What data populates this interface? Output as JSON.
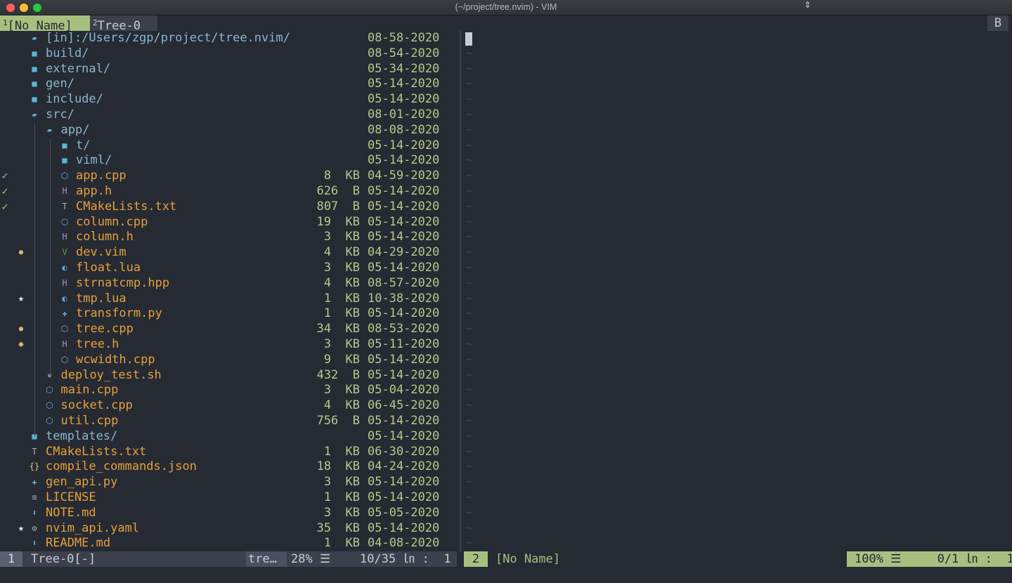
{
  "window": {
    "title": "(~/project/tree.nvim) - VIM"
  },
  "tabline": {
    "tabs": [
      {
        "number": "1",
        "label": "[No Name]",
        "active": true
      },
      {
        "number": "2",
        "label": "Tree-0",
        "active": false
      }
    ],
    "right_indicator": "B"
  },
  "tree": {
    "rows": [
      {
        "name": "[in]:/Users/zgp/project/tree.nvim/",
        "kind": "dir",
        "icon": "folder-open-icon",
        "depth": 0,
        "size": "",
        "date": "08-58-2020",
        "git": "",
        "mark": ""
      },
      {
        "name": "build/",
        "kind": "dir",
        "icon": "folder-icon",
        "depth": 0,
        "size": "",
        "date": "08-54-2020",
        "git": "",
        "mark": ""
      },
      {
        "name": "external/",
        "kind": "dir",
        "icon": "folder-icon",
        "depth": 0,
        "size": "",
        "date": "05-34-2020",
        "git": "",
        "mark": ""
      },
      {
        "name": "gen/",
        "kind": "dir",
        "icon": "folder-icon",
        "depth": 0,
        "size": "",
        "date": "05-14-2020",
        "git": "",
        "mark": ""
      },
      {
        "name": "include/",
        "kind": "dir",
        "icon": "folder-icon",
        "depth": 0,
        "size": "",
        "date": "05-14-2020",
        "git": "",
        "mark": ""
      },
      {
        "name": "src/",
        "kind": "dir",
        "icon": "folder-open-icon",
        "depth": 0,
        "size": "",
        "date": "08-01-2020",
        "git": "",
        "mark": ""
      },
      {
        "name": "app/",
        "kind": "dir",
        "icon": "folder-open-icon",
        "depth": 1,
        "size": "",
        "date": "08-08-2020",
        "git": "",
        "mark": ""
      },
      {
        "name": "t/",
        "kind": "dir",
        "icon": "folder-icon",
        "depth": 2,
        "size": "",
        "date": "05-14-2020",
        "git": "",
        "mark": ""
      },
      {
        "name": "viml/",
        "kind": "dir",
        "icon": "folder-icon",
        "depth": 2,
        "size": "",
        "date": "05-14-2020",
        "git": "",
        "mark": ""
      },
      {
        "name": "app.cpp",
        "kind": "file",
        "icon": "cpp-icon",
        "depth": 2,
        "size": "8  KB",
        "date": "04-59-2020",
        "git": "✓",
        "mark": ""
      },
      {
        "name": "app.h",
        "kind": "file",
        "icon": "header-icon",
        "depth": 2,
        "size": "626  B",
        "date": "05-14-2020",
        "git": "✓",
        "mark": ""
      },
      {
        "name": "CMakeLists.txt",
        "kind": "file",
        "icon": "text-icon",
        "depth": 2,
        "size": "807  B",
        "date": "05-14-2020",
        "git": "✓",
        "mark": ""
      },
      {
        "name": "column.cpp",
        "kind": "file",
        "icon": "cpp-icon",
        "depth": 2,
        "size": "19  KB",
        "date": "05-14-2020",
        "git": "",
        "mark": ""
      },
      {
        "name": "column.h",
        "kind": "file",
        "icon": "header-icon",
        "depth": 2,
        "size": "3  KB",
        "date": "05-14-2020",
        "git": "",
        "mark": ""
      },
      {
        "name": "dev.vim",
        "kind": "file",
        "icon": "vim-icon",
        "depth": 2,
        "size": "4  KB",
        "date": "04-29-2020",
        "git": "",
        "mark": "✹"
      },
      {
        "name": "float.lua",
        "kind": "file",
        "icon": "lua-icon",
        "depth": 2,
        "size": "3  KB",
        "date": "05-14-2020",
        "git": "",
        "mark": ""
      },
      {
        "name": "strnatcmp.hpp",
        "kind": "file",
        "icon": "header-icon",
        "depth": 2,
        "size": "4  KB",
        "date": "08-57-2020",
        "git": "",
        "mark": ""
      },
      {
        "name": "tmp.lua",
        "kind": "file",
        "icon": "lua-icon",
        "depth": 2,
        "size": "1  KB",
        "date": "10-38-2020",
        "git": "",
        "mark": "★"
      },
      {
        "name": "transform.py",
        "kind": "file",
        "icon": "python-icon",
        "depth": 2,
        "size": "1  KB",
        "date": "05-14-2020",
        "git": "",
        "mark": ""
      },
      {
        "name": "tree.cpp",
        "kind": "file",
        "icon": "cpp-icon",
        "depth": 2,
        "size": "34  KB",
        "date": "08-53-2020",
        "git": "",
        "mark": "✹"
      },
      {
        "name": "tree.h",
        "kind": "file",
        "icon": "header-icon",
        "depth": 2,
        "size": "3  KB",
        "date": "05-11-2020",
        "git": "",
        "mark": "✹"
      },
      {
        "name": "wcwidth.cpp",
        "kind": "file",
        "icon": "cpp-icon",
        "depth": 2,
        "size": "9  KB",
        "date": "05-14-2020",
        "git": "",
        "mark": ""
      },
      {
        "name": "deploy_test.sh",
        "kind": "file",
        "icon": "shell-icon",
        "depth": 1,
        "size": "432  B",
        "date": "05-14-2020",
        "git": "",
        "mark": ""
      },
      {
        "name": "main.cpp",
        "kind": "file",
        "icon": "cpp-icon",
        "depth": 1,
        "size": "3  KB",
        "date": "05-04-2020",
        "git": "",
        "mark": ""
      },
      {
        "name": "socket.cpp",
        "kind": "file",
        "icon": "cpp-icon",
        "depth": 1,
        "size": "4  KB",
        "date": "06-45-2020",
        "git": "",
        "mark": ""
      },
      {
        "name": "util.cpp",
        "kind": "file",
        "icon": "cpp-icon",
        "depth": 1,
        "size": "756  B",
        "date": "05-14-2020",
        "git": "",
        "mark": ""
      },
      {
        "name": "templates/",
        "kind": "dir",
        "icon": "folder-icon",
        "depth": 0,
        "size": "",
        "date": "05-14-2020",
        "git": "",
        "mark": ""
      },
      {
        "name": "CMakeLists.txt",
        "kind": "file",
        "icon": "text-icon",
        "depth": 0,
        "size": "1  KB",
        "date": "06-30-2020",
        "git": "",
        "mark": ""
      },
      {
        "name": "compile_commands.json",
        "kind": "file",
        "icon": "json-icon",
        "depth": 0,
        "size": "18  KB",
        "date": "04-24-2020",
        "git": "",
        "mark": ""
      },
      {
        "name": "gen_api.py",
        "kind": "file",
        "icon": "python-icon",
        "depth": 0,
        "size": "3  KB",
        "date": "05-14-2020",
        "git": "",
        "mark": ""
      },
      {
        "name": "LICENSE",
        "kind": "file",
        "icon": "license-icon",
        "depth": 0,
        "size": "1  KB",
        "date": "05-14-2020",
        "git": "",
        "mark": ""
      },
      {
        "name": "NOTE.md",
        "kind": "file",
        "icon": "markdown-icon",
        "depth": 0,
        "size": "3  KB",
        "date": "05-05-2020",
        "git": "",
        "mark": ""
      },
      {
        "name": "nvim_api.yaml",
        "kind": "file",
        "icon": "yaml-icon",
        "depth": 0,
        "size": "35  KB",
        "date": "05-14-2020",
        "git": "",
        "mark": "★"
      },
      {
        "name": "README.md",
        "kind": "file",
        "icon": "markdown-icon",
        "depth": 0,
        "size": "1  KB",
        "date": "04-08-2020",
        "git": "",
        "mark": ""
      }
    ]
  },
  "editor": {
    "tilde": "~",
    "empty_line_count": 33
  },
  "statusline": {
    "left": {
      "window_number": "1",
      "buffer_name": "Tree-0[-]",
      "filetype": "tre…",
      "percent": "28% ☰",
      "position": "10/35 ㏑ :  1"
    },
    "right": {
      "window_number": "2",
      "buffer_name": "[No Name]",
      "position": "100% ☰     0/1 ㏑ :  1"
    }
  },
  "colors": {
    "background": "#262a33",
    "accent_green": "#a7c080",
    "dir": "#8ab7cf",
    "file": "#e5a13b",
    "meta": "#b5c98a"
  }
}
